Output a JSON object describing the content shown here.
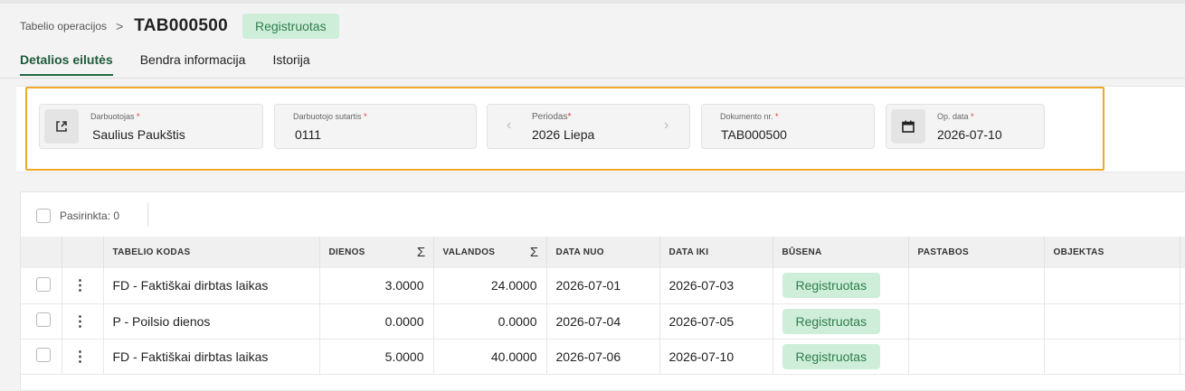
{
  "breadcrumb": {
    "parent": "Tabelio operacijos",
    "separator": ">",
    "title": "TAB000500",
    "status": "Registruotas"
  },
  "tabs": [
    {
      "label": "Detalios eilutės",
      "active": true
    },
    {
      "label": "Bendra informacija",
      "active": false
    },
    {
      "label": "Istorija",
      "active": false
    }
  ],
  "header_fields": {
    "employee": {
      "label": "Darbuotojas",
      "required": "*",
      "value": "Saulius Paukštis",
      "icon": "open-external-icon"
    },
    "contract": {
      "label": "Darbuotojo sutartis",
      "required": "*",
      "value": "0111"
    },
    "period": {
      "label": "Periodas",
      "required": "*",
      "value": "2026 Liepa",
      "prev": "‹",
      "next": "›"
    },
    "document_no": {
      "label": "Dokumento nr.",
      "required": "*",
      "value": "TAB000500"
    },
    "op_date": {
      "label": "Op. data",
      "required": "*",
      "value": "2026-07-10",
      "icon": "calendar-icon"
    }
  },
  "grid": {
    "selected_label": "Pasirinkta: 0",
    "columns": [
      "TABELIO KODAS",
      "DIENOS",
      "VALANDOS",
      "DATA NUO",
      "DATA IKI",
      "BŪSENA",
      "PASTABOS",
      "OBJEKTAS"
    ],
    "sum_symbol": "Σ",
    "row_menu_symbol": "⋮",
    "rows": [
      {
        "code": "FD - Faktiškai dirbtas laikas",
        "days": "3.0000",
        "hours": "24.0000",
        "from": "2026-07-01",
        "to": "2026-07-03",
        "status": "Registruotas",
        "notes": "",
        "object": ""
      },
      {
        "code": "P - Poilsio dienos",
        "days": "0.0000",
        "hours": "0.0000",
        "from": "2026-07-04",
        "to": "2026-07-05",
        "status": "Registruotas",
        "notes": "",
        "object": ""
      },
      {
        "code": "FD - Faktiškai dirbtas laikas",
        "days": "5.0000",
        "hours": "40.0000",
        "from": "2026-07-06",
        "to": "2026-07-10",
        "status": "Registruotas",
        "notes": "",
        "object": ""
      }
    ]
  },
  "colors": {
    "accent_green": "#1f6b45",
    "status_bg": "#cfeeda",
    "status_text": "#2e7d4a",
    "highlight": "#f0a82a"
  }
}
